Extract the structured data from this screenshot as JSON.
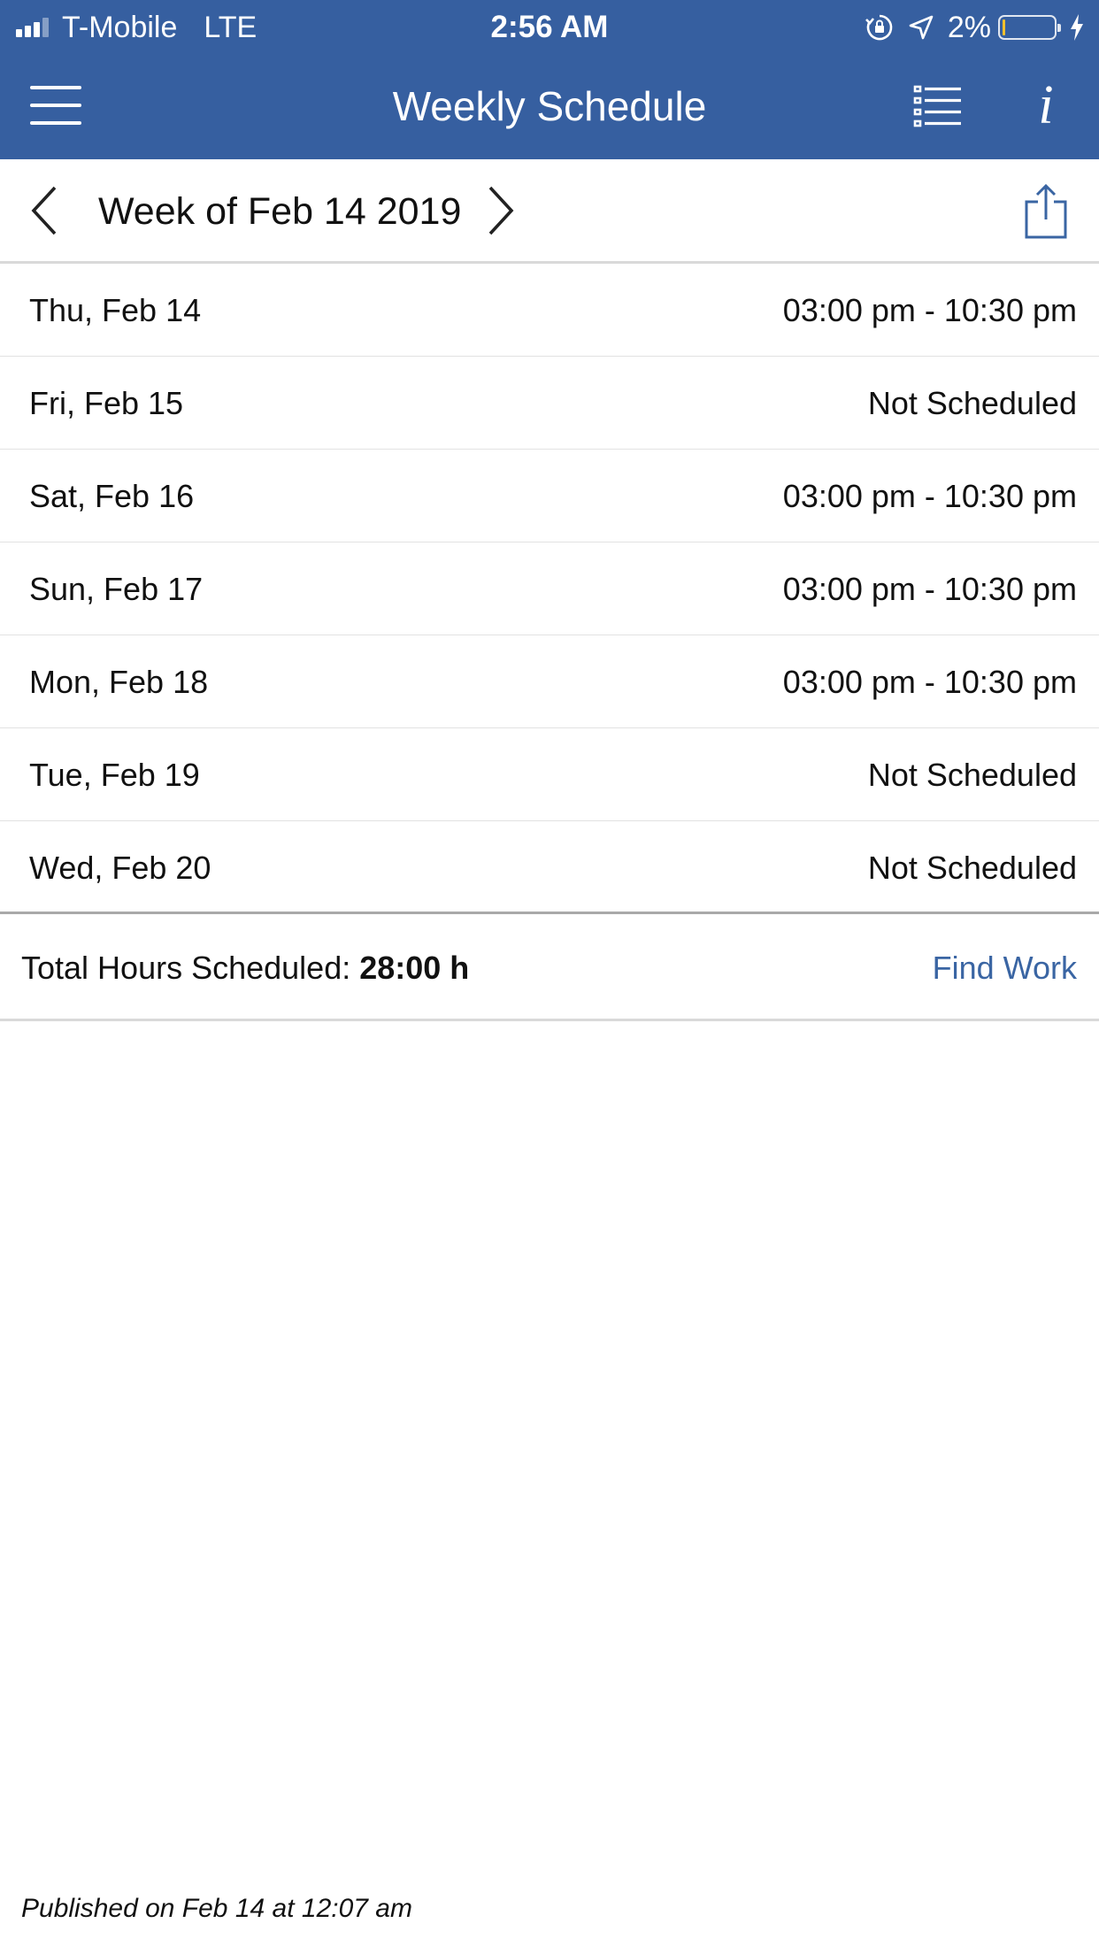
{
  "status_bar": {
    "carrier": "T-Mobile",
    "network": "LTE",
    "time": "2:56 AM",
    "battery": "2%",
    "battery_level": 0.02,
    "signal_bars": 3
  },
  "nav": {
    "title": "Weekly Schedule"
  },
  "week": {
    "title": "Week of Feb 14 2019"
  },
  "days": [
    {
      "label": "Thu, Feb 14",
      "shift": "03:00 pm - 10:30 pm"
    },
    {
      "label": "Fri, Feb 15",
      "shift": "Not Scheduled"
    },
    {
      "label": "Sat, Feb 16",
      "shift": "03:00 pm - 10:30 pm"
    },
    {
      "label": "Sun, Feb 17",
      "shift": "03:00 pm - 10:30 pm"
    },
    {
      "label": "Mon, Feb 18",
      "shift": "03:00 pm - 10:30 pm"
    },
    {
      "label": "Tue, Feb 19",
      "shift": "Not Scheduled"
    },
    {
      "label": "Wed, Feb 20",
      "shift": "Not Scheduled"
    }
  ],
  "totals": {
    "label": "Total Hours Scheduled: ",
    "value": "28:00 h",
    "find_work": "Find Work"
  },
  "footer": {
    "published": "Published on Feb 14 at 12:07 am"
  },
  "colors": {
    "header_bg": "#365fa0",
    "link": "#3a65a3",
    "battery_low": "#f2c12e"
  }
}
